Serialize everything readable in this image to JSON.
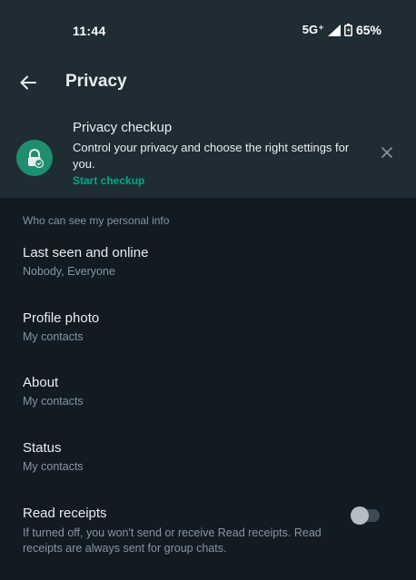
{
  "status_bar": {
    "time": "11:44",
    "network": "5G⁺",
    "battery": "65%"
  },
  "app_bar": {
    "title": "Privacy"
  },
  "checkup": {
    "title": "Privacy checkup",
    "description": "Control your privacy and choose the right settings for you.",
    "link": "Start checkup",
    "icon": "lock-check-icon",
    "accent": "#00a884"
  },
  "section": {
    "header": "Who can see my personal info"
  },
  "items": [
    {
      "title": "Last seen and online",
      "subtitle": "Nobody, Everyone"
    },
    {
      "title": "Profile photo",
      "subtitle": "My contacts"
    },
    {
      "title": "About",
      "subtitle": "My contacts"
    },
    {
      "title": "Status",
      "subtitle": "My contacts"
    },
    {
      "title": "Read receipts",
      "subtitle": "If turned off, you won't send or receive Read receipts. Read receipts are always sent for group chats.",
      "toggle_on": false
    }
  ]
}
